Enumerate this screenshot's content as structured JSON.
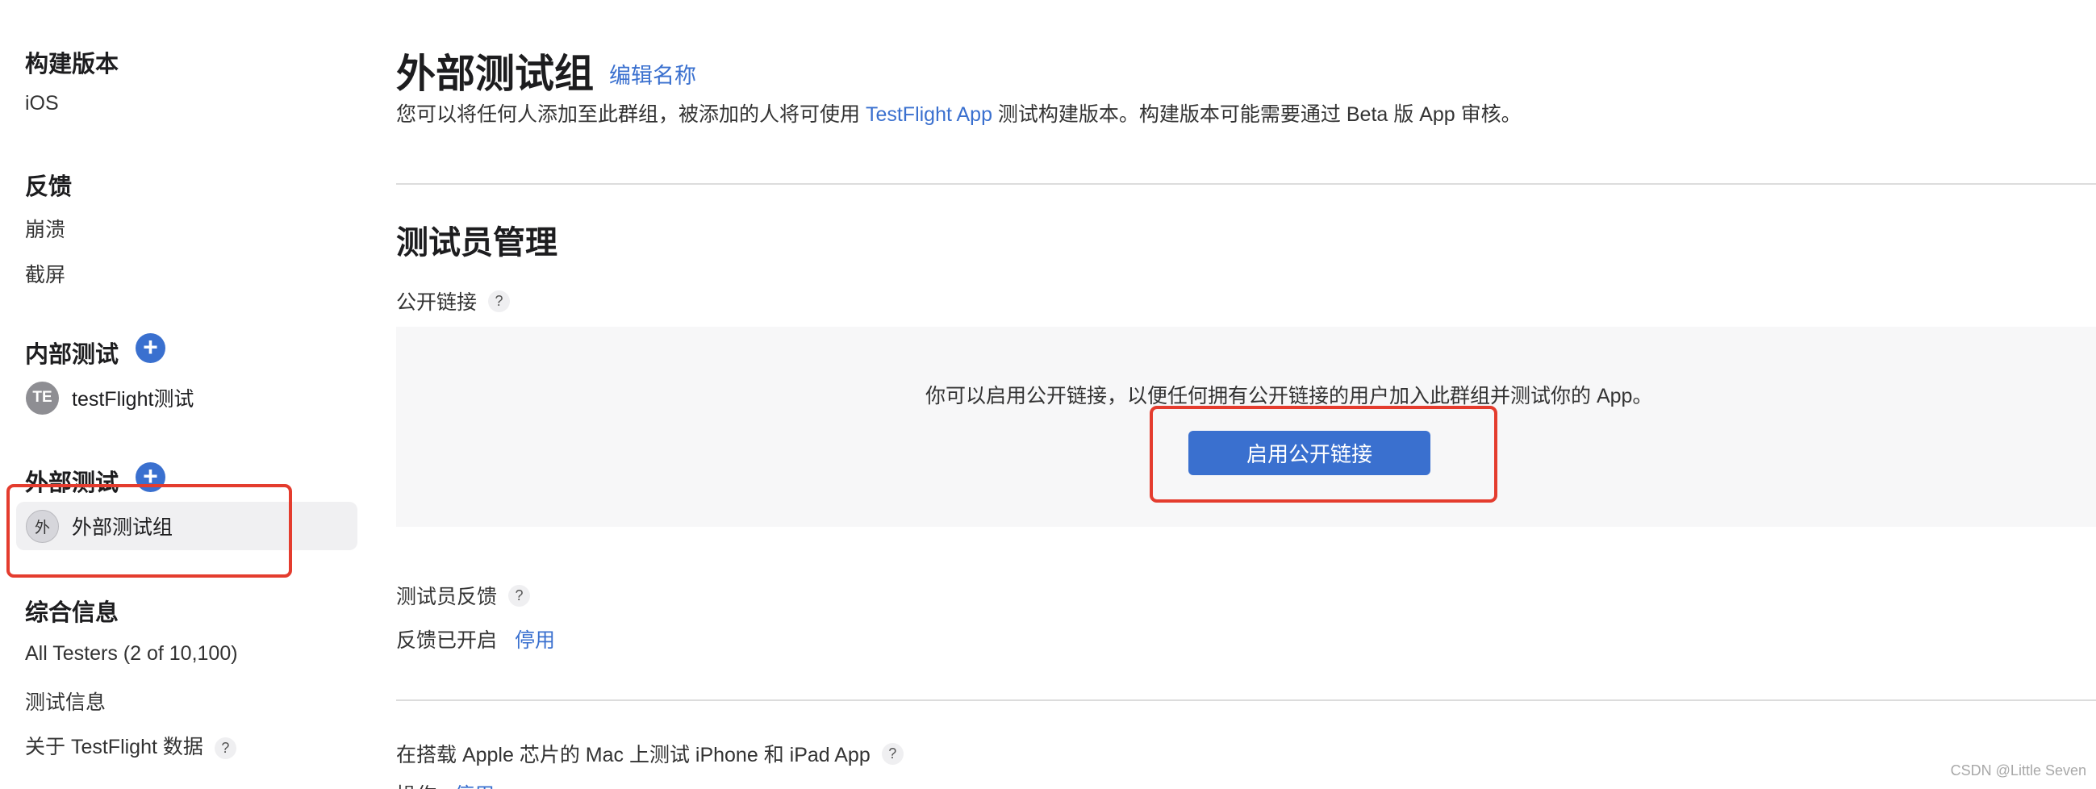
{
  "sidebar": {
    "build_section": {
      "title": "构建版本",
      "items": [
        "iOS"
      ]
    },
    "feedback_section": {
      "title": "反馈",
      "items": [
        "崩溃",
        "截屏"
      ]
    },
    "internal_section": {
      "title": "内部测试",
      "groups": [
        {
          "avatar": "TE",
          "label": "testFlight测试"
        }
      ]
    },
    "external_section": {
      "title": "外部测试",
      "groups": [
        {
          "avatar": "外",
          "label": "外部测试组"
        }
      ]
    },
    "info_section": {
      "title": "综合信息",
      "items": [
        "All Testers (2 of 10,100)",
        "测试信息",
        "关于 TestFlight 数据"
      ]
    },
    "help_glyph": "?"
  },
  "main": {
    "title": "外部测试组",
    "edit_name": "编辑名称",
    "description_prefix": "您可以将任何人添加至此群组，被添加的人将可使用 ",
    "description_link": "TestFlight App",
    "description_suffix": " 测试构建版本。构建版本可能需要通过 Beta 版 App 审核。",
    "tester_management_title": "测试员管理",
    "public_link_label": "公开链接",
    "public_link_text": "你可以启用公开链接，以便任何拥有公开链接的用户加入此群组并测试你的 App。",
    "enable_public_link_button": "启用公开链接",
    "tester_feedback_label": "测试员反馈",
    "feedback_status": "反馈已开启",
    "feedback_disable": "停用",
    "mac_testing_label": "在搭载 Apple 芯片的 Mac 上测试 iPhone 和 iPad App",
    "mac_status_partial": "操作",
    "mac_disable_partial": "停用"
  },
  "colors": {
    "accent": "#3a70cf",
    "annotation": "#e43c2e",
    "panel": "#f7f7f8"
  },
  "watermark": "CSDN @Little Seven"
}
